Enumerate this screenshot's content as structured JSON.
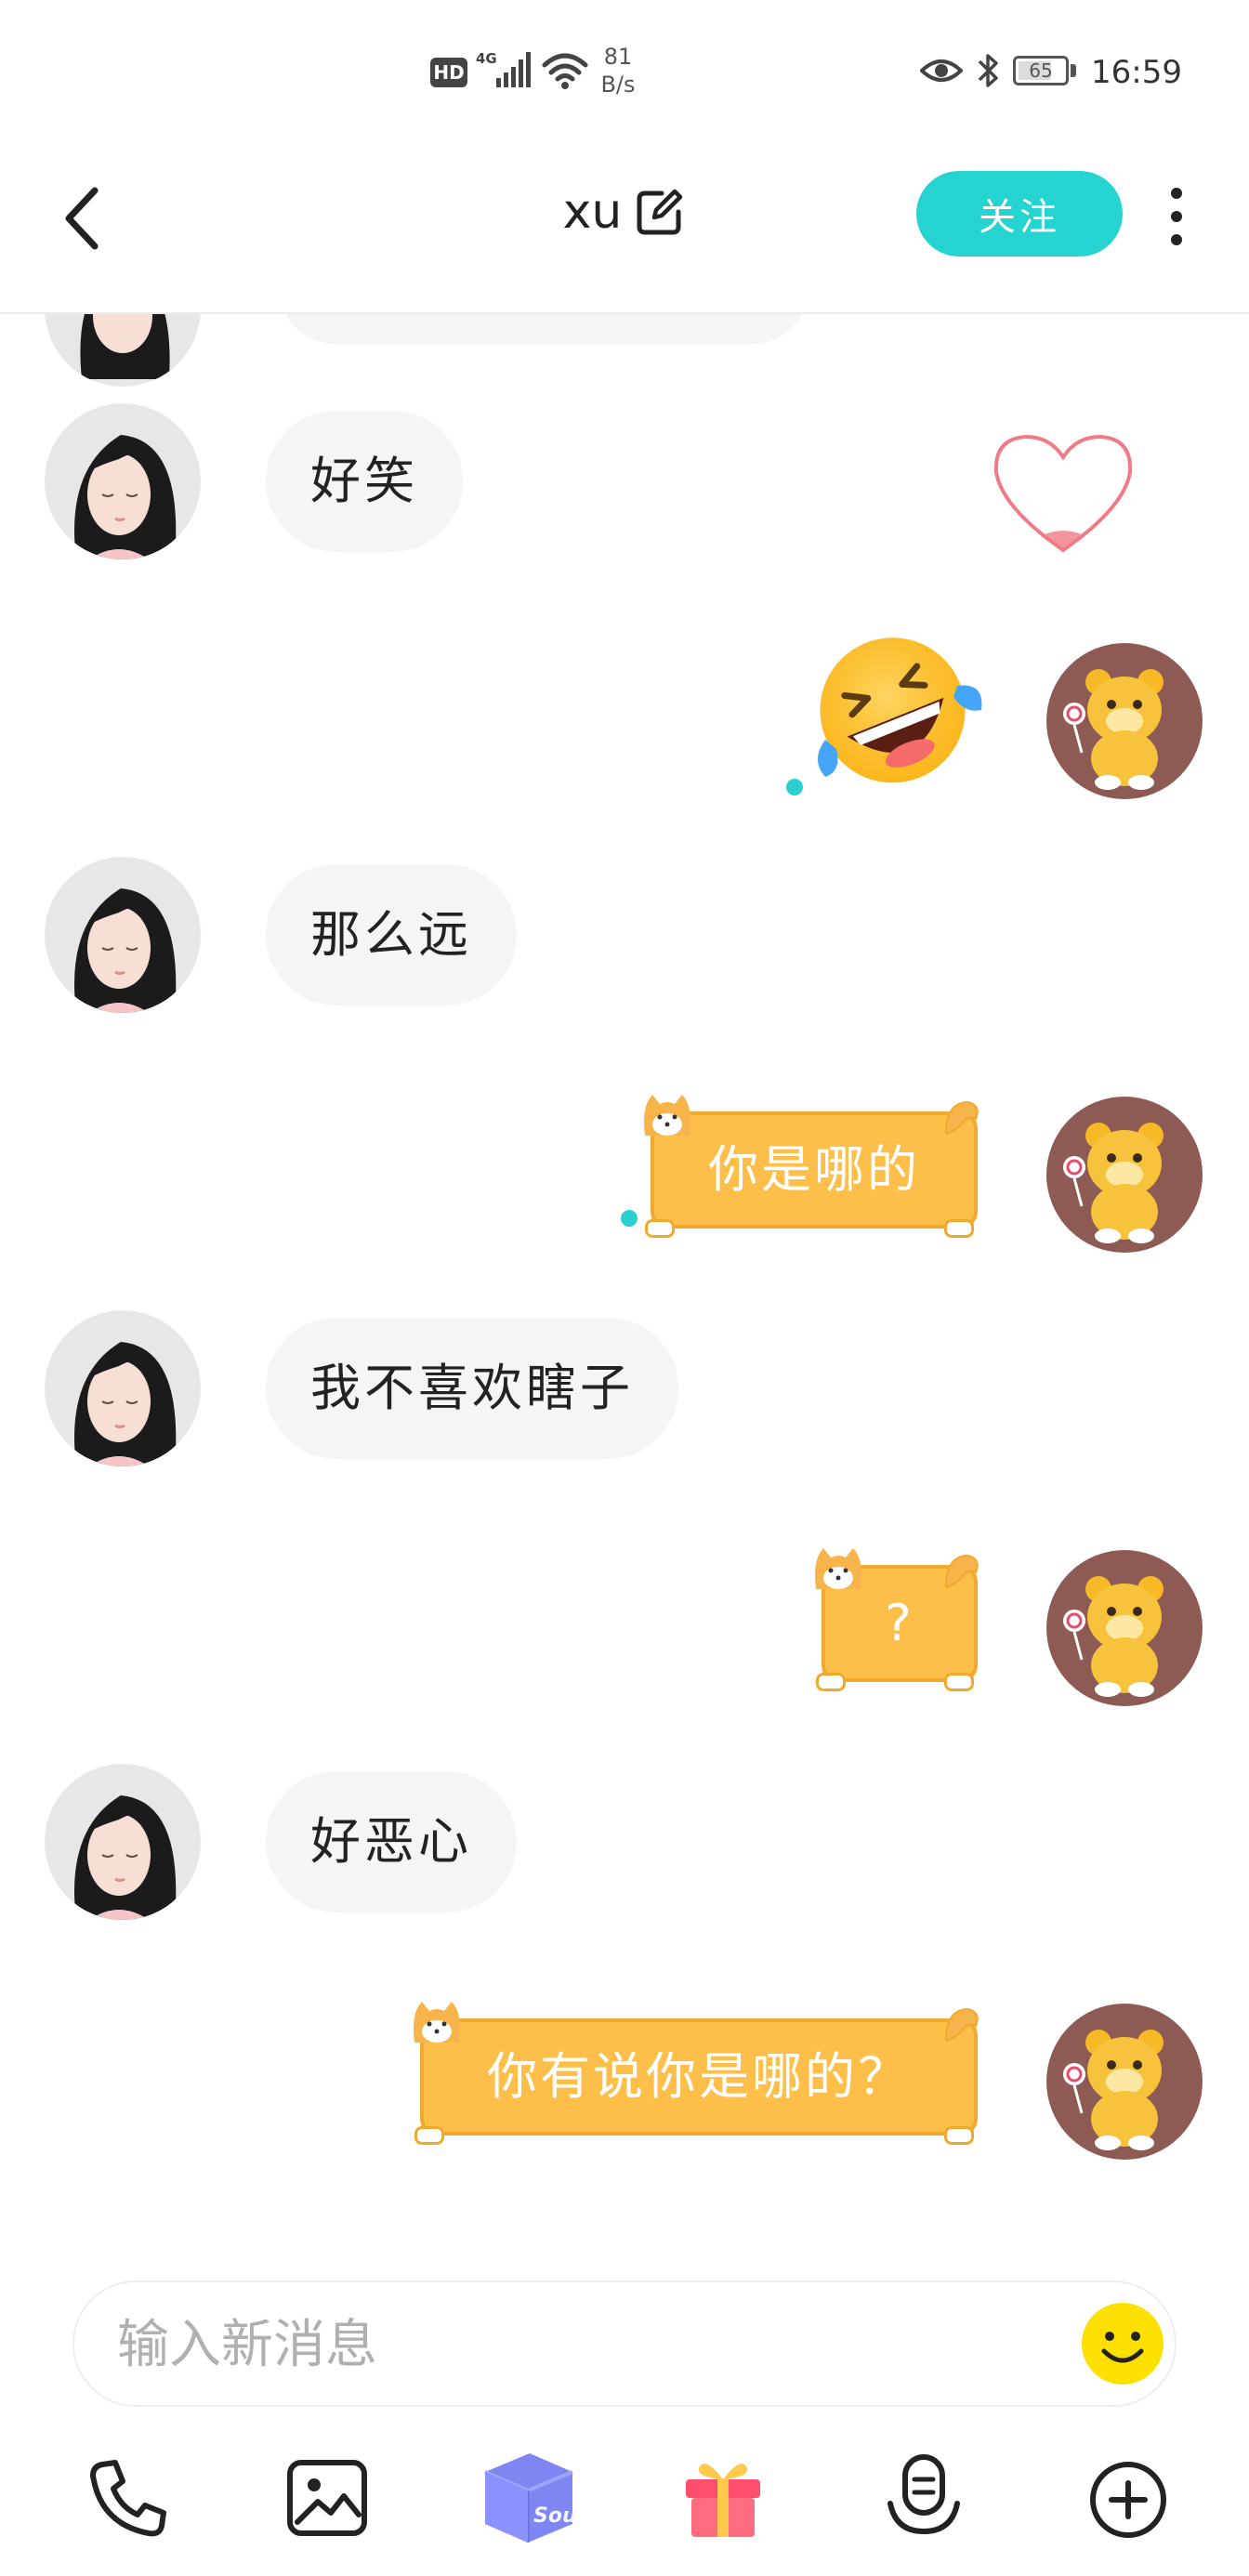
{
  "status_bar": {
    "hd": "HD",
    "network": "4G",
    "speed_value": "81",
    "speed_unit": "B/s",
    "battery": "65",
    "time": "16:59"
  },
  "header": {
    "title": "xu",
    "follow_label": "关注"
  },
  "messages": [
    {
      "side": "left",
      "type": "text",
      "text": "好笑"
    },
    {
      "side": "right",
      "type": "emoji",
      "icon": "rolling-laughing-emoji"
    },
    {
      "side": "left",
      "type": "text",
      "text": "那么远"
    },
    {
      "side": "right",
      "type": "shiba-bubble",
      "text": "你是哪的"
    },
    {
      "side": "left",
      "type": "text",
      "text": "我不喜欢瞎子"
    },
    {
      "side": "right",
      "type": "shiba-bubble",
      "text": "?"
    },
    {
      "side": "left",
      "type": "text",
      "text": "好恶心"
    },
    {
      "side": "right",
      "type": "shiba-bubble",
      "text": "你有说你是哪的？"
    }
  ],
  "input": {
    "placeholder": "输入新消息"
  },
  "toolbar": {
    "items": [
      "phone-icon",
      "image-icon",
      "soul-box-icon",
      "gift-icon",
      "voice-icon",
      "plus-icon"
    ],
    "soul_box_label": "Soul"
  },
  "colors": {
    "accent": "#25d4d0",
    "bubble_orange": "#fdbf4a",
    "bubble_grey": "#f5f5f5",
    "avatar_right_bg": "#8d5b54"
  }
}
